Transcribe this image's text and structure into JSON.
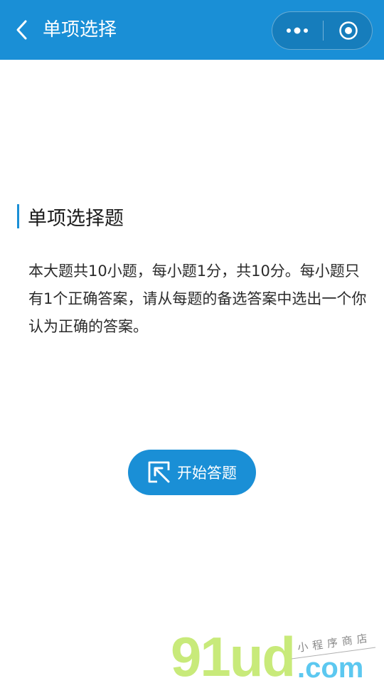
{
  "navbar": {
    "title": "单项选择",
    "back_icon": "chevron-left-icon",
    "more_icon": "more-dots-icon",
    "close_icon": "mini-program-close-icon",
    "background_color": "#1a8fd6"
  },
  "section": {
    "heading": "单项选择题",
    "accent_color": "#1a8fd6"
  },
  "instructions": {
    "text": "本大题共10小题，每小题1分，共10分。每小题只有1个正确答案，请从每题的备选答案中选出一个你认为正确的答案。"
  },
  "start_button": {
    "label": "开始答题",
    "icon": "cursor-click-icon",
    "color": "#1a8fd6"
  },
  "watermark": {
    "brand": "91ud",
    "domain": ".com",
    "tagline": "小程序商店"
  }
}
